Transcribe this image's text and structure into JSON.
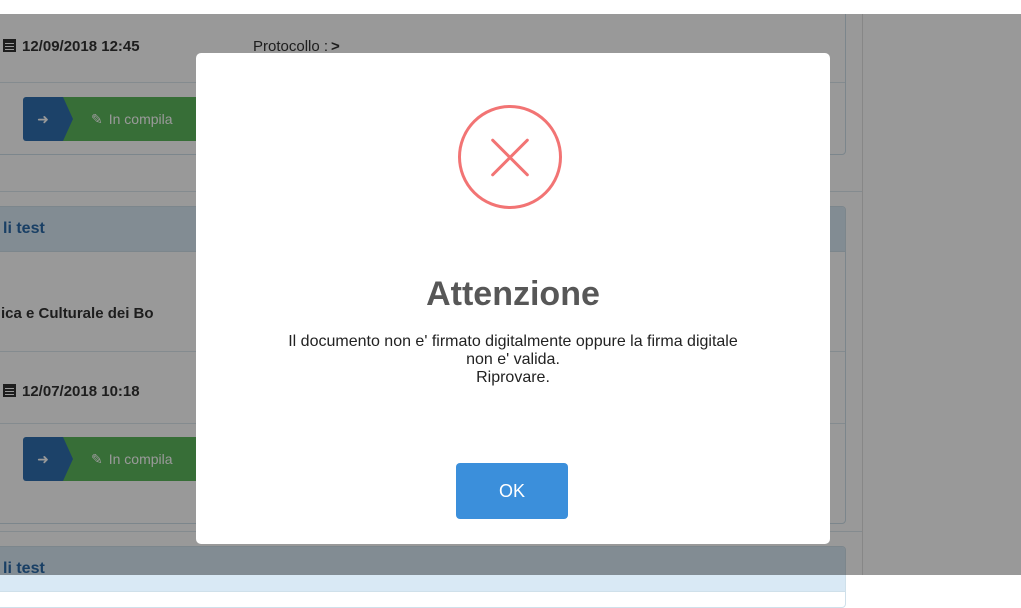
{
  "background": {
    "record1": {
      "date": "12/09/2018 12:45",
      "protocol_label": "Protocollo :",
      "protocol_arrow": ">",
      "status_button": "In compila"
    },
    "record2": {
      "header": "li test",
      "entity": "ica e Culturale dei Bo",
      "date": "12/07/2018 10:18",
      "status_button": "In compila"
    },
    "record3": {
      "header": "li test"
    }
  },
  "dialog": {
    "icon": "error-x-icon",
    "title": "Attenzione",
    "message_line1": "Il documento non e' firmato digitalmente oppure la firma digitale",
    "message_line2": "non e' valida.",
    "message_line3": "Riprovare.",
    "ok_label": "OK"
  },
  "colors": {
    "error": "#f27474",
    "primary": "#3b8fdb",
    "step_blue": "#2f6fb0",
    "step_green": "#5cb85c",
    "panel_header": "#d9e9f5"
  }
}
